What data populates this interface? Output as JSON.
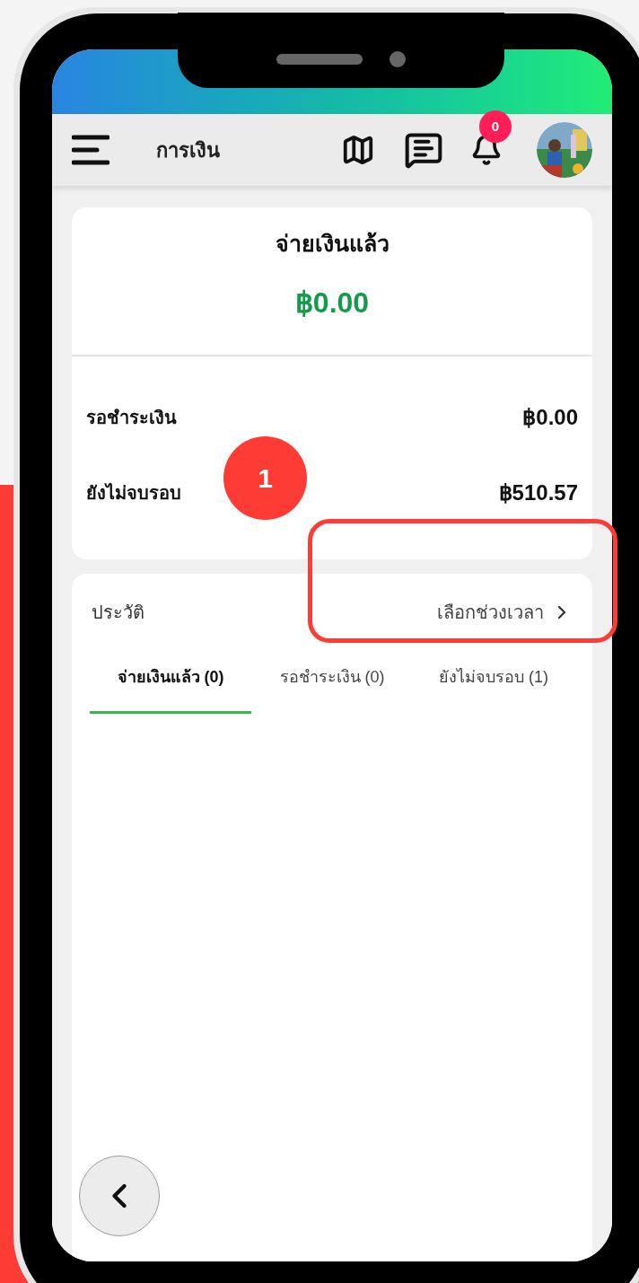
{
  "header": {
    "title": "การเงิน",
    "notification_count": "0"
  },
  "summary": {
    "title": "จ่ายเงินแล้ว",
    "amount": "฿0.00",
    "rows": [
      {
        "label": "รอชำระเงิน",
        "value": "฿0.00"
      },
      {
        "label": "ยังไม่จบรอบ",
        "value": "฿510.57"
      }
    ]
  },
  "history": {
    "title": "ประวัติ",
    "range_link": "เลือกช่วงเวลา",
    "tabs": [
      {
        "label": "จ่ายเงินแล้ว (0)",
        "selected": true
      },
      {
        "label": "รอชำระเงิน (0)",
        "selected": false
      },
      {
        "label": "ยังไม่จบรอบ (1)",
        "selected": false
      }
    ]
  },
  "annotation": {
    "marker": "1"
  }
}
